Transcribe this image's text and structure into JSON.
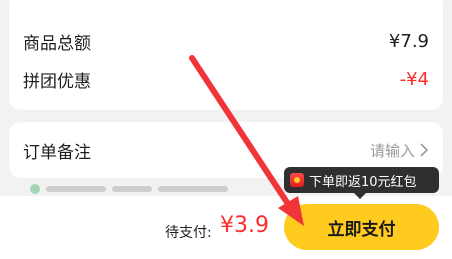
{
  "price_card": {
    "total_label": "商品总额",
    "total_value": "¥7.9",
    "discount_label": "拼团优惠",
    "discount_value": "-¥4"
  },
  "note_card": {
    "label": "订单备注",
    "placeholder": "请输入"
  },
  "promo_tooltip": {
    "text": "下单即返10元红包",
    "icon": "redpacket-icon"
  },
  "checkout": {
    "pay_label": "待支付:",
    "pay_amount": "¥3.9",
    "button_label": "立即支付"
  },
  "colors": {
    "accent_button": "#ffcb1f",
    "price_red": "#ff2d2d",
    "annotation_arrow": "#f0343a"
  }
}
